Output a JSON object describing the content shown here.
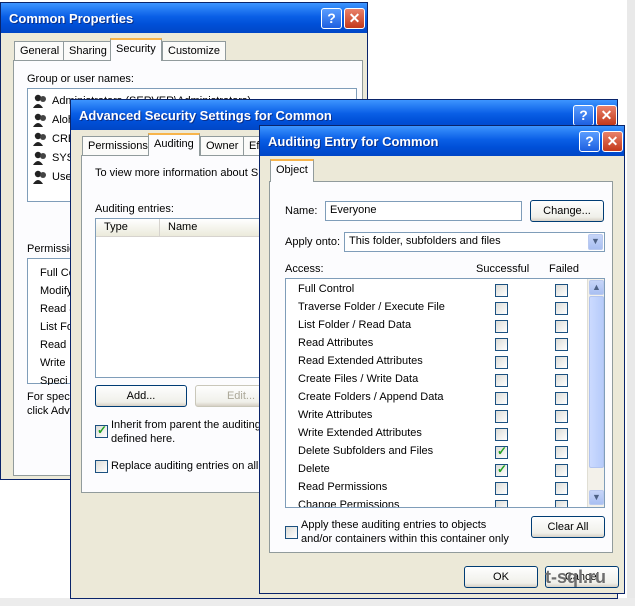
{
  "common": {
    "title": "Common Properties",
    "tabs": [
      "General",
      "Sharing",
      "Security",
      "Customize"
    ],
    "group_label": "Group or user names:",
    "users": [
      "Administrators (SERVER\\Administrators)",
      "Aloh",
      "CRE",
      "SYS",
      "Use"
    ],
    "perm_label": "Permission",
    "perms": [
      "Full Co",
      "Modify",
      "Read &",
      "List Fo",
      "Read",
      "Write",
      "Speci"
    ],
    "special_text": [
      "For speci",
      "click Adv"
    ]
  },
  "advanced": {
    "title": "Advanced Security Settings for Common",
    "tabs": [
      "Permissions",
      "Auditing",
      "Owner",
      "Eff"
    ],
    "info": "To view more information about Spe",
    "entries_label": "Auditing entries:",
    "columns": [
      "Type",
      "Name"
    ],
    "add_label": "Add...",
    "edit_label": "Edit...",
    "inherit_text": [
      "Inherit from parent the auditing e",
      "defined here."
    ],
    "replace_text": "Replace auditing entries on all c"
  },
  "entry": {
    "title": "Auditing Entry for Common",
    "tab": "Object",
    "name_label": "Name:",
    "name_value": "Everyone",
    "change_label": "Change...",
    "apply_label": "Apply onto:",
    "apply_value": "This folder, subfolders and files",
    "access_label": "Access:",
    "successful_label": "Successful",
    "failed_label": "Failed",
    "rows": [
      {
        "label": "Full Control",
        "success": false,
        "failed": false
      },
      {
        "label": "Traverse Folder / Execute File",
        "success": false,
        "failed": false
      },
      {
        "label": "List Folder / Read Data",
        "success": false,
        "failed": false
      },
      {
        "label": "Read Attributes",
        "success": false,
        "failed": false
      },
      {
        "label": "Read Extended Attributes",
        "success": false,
        "failed": false
      },
      {
        "label": "Create Files / Write Data",
        "success": false,
        "failed": false
      },
      {
        "label": "Create Folders / Append Data",
        "success": false,
        "failed": false
      },
      {
        "label": "Write Attributes",
        "success": false,
        "failed": false
      },
      {
        "label": "Write Extended Attributes",
        "success": false,
        "failed": false
      },
      {
        "label": "Delete Subfolders and Files",
        "success": true,
        "failed": false
      },
      {
        "label": "Delete",
        "success": true,
        "failed": false
      },
      {
        "label": "Read Permissions",
        "success": false,
        "failed": false
      },
      {
        "label": "Change Permissions",
        "success": false,
        "failed": false
      }
    ],
    "apply_these_text": [
      "Apply these auditing entries to objects",
      "and/or containers within this container only"
    ],
    "clear_all_label": "Clear All",
    "ok_label": "OK",
    "cancel_label": "Cancel"
  },
  "watermark": "t-sql.ru"
}
